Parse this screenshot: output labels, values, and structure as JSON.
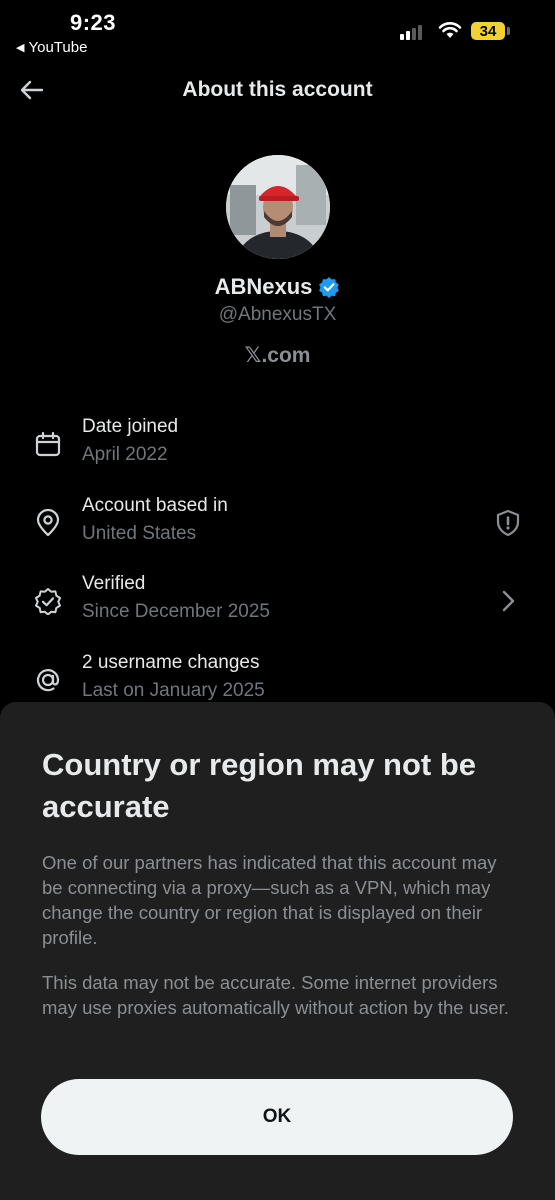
{
  "status_bar": {
    "time": "9:23",
    "back_app": "YouTube",
    "battery": "34",
    "battery_color": "#f2d232"
  },
  "header": {
    "title": "About this account",
    "back_icon": "arrow-left-icon"
  },
  "profile": {
    "display_name": "ABNexus",
    "handle": "@AbnexusTX",
    "site": "𝕏.com",
    "verified_color": "#1d9bf0"
  },
  "info": {
    "date_joined": {
      "label": "Date joined",
      "value": "April 2022",
      "icon": "calendar-icon"
    },
    "account_based": {
      "label": "Account based in",
      "value": "United States",
      "icon": "location-pin-icon"
    },
    "verified": {
      "label": "Verified",
      "value": "Since December 2025",
      "icon": "verified-badge-icon"
    },
    "username_changes": {
      "label": "2 username changes",
      "value": "Last on January 2025",
      "icon": "at-sign-icon"
    }
  },
  "sheet": {
    "title": "Country or region may not be accurate",
    "paragraph1": "One of our partners has indicated that this account may be connecting via a proxy—such as a VPN, which may change the country or region that is displayed on their profile.",
    "paragraph2": "This data may not be accurate. Some internet providers may use proxies automatically without action by the user.",
    "ok_label": "OK"
  }
}
